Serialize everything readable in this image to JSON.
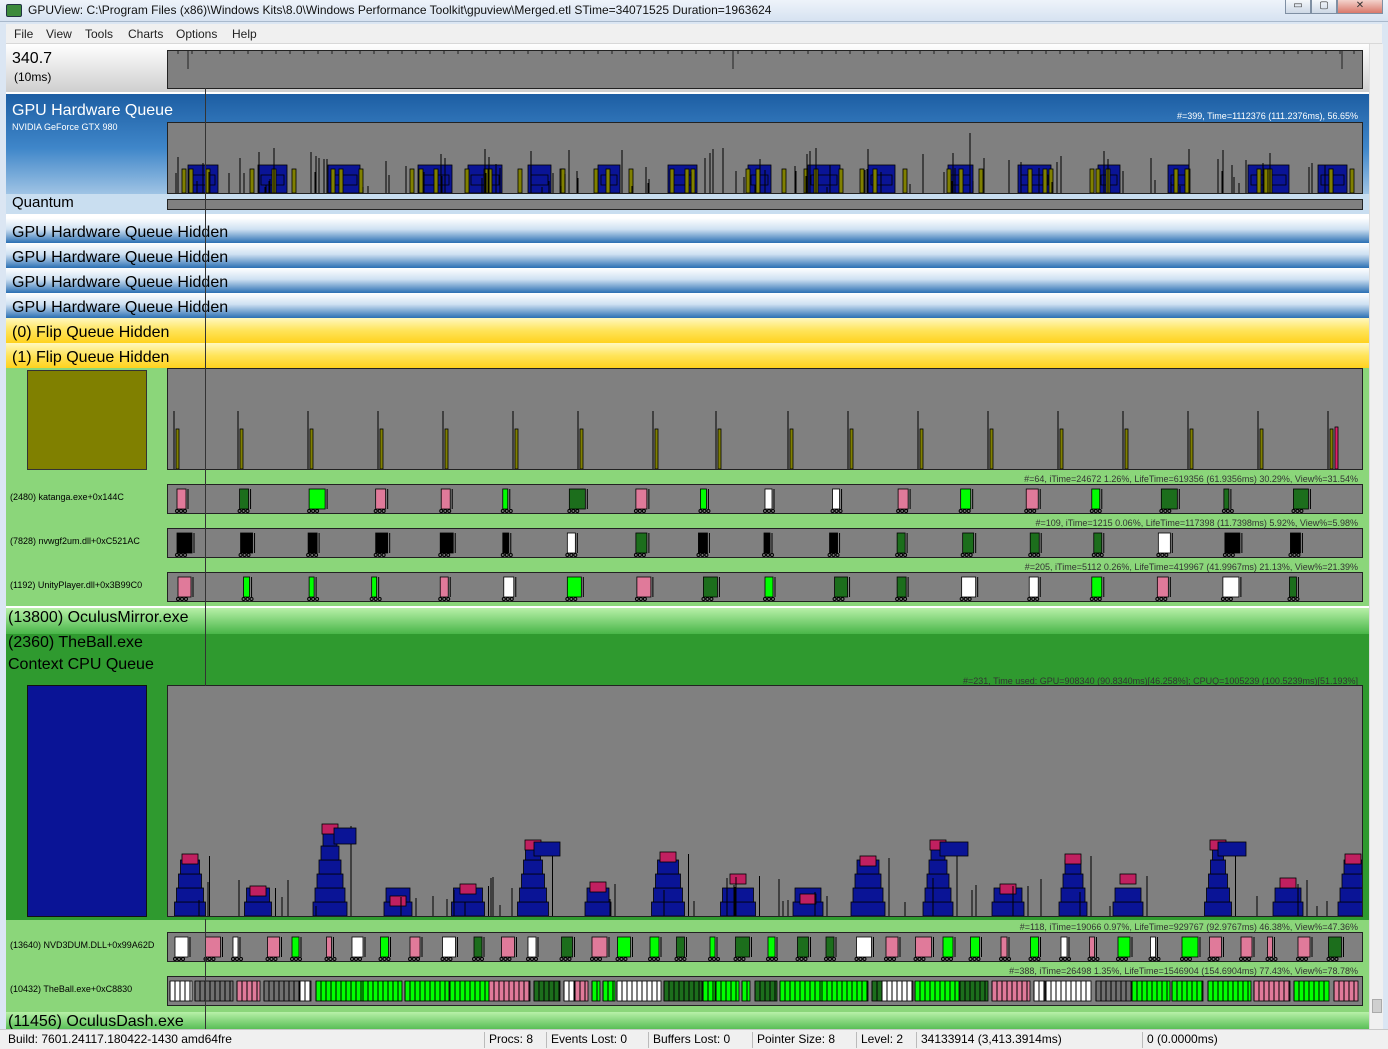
{
  "window": {
    "title": "GPUView: C:\\Program Files (x86)\\Windows Kits\\8.0\\Windows Performance Toolkit\\gpuview\\Merged.etl STime=34071525 Duration=1963624",
    "min_glyph": "▭",
    "max_glyph": "▢",
    "close_glyph": "✕"
  },
  "menu": [
    "File",
    "View",
    "Tools",
    "Charts",
    "Options",
    "Help"
  ],
  "ruler": {
    "value": "340.7",
    "unit": "(10ms)"
  },
  "gpu_queue": {
    "title": "GPU Hardware Queue",
    "device": "NVIDIA GeForce GTX 980",
    "stats": "#=399,  Time=1112376 (111.2376ms),  56.65%",
    "quantum_label": "Quantum"
  },
  "hidden_rows": [
    "GPU Hardware Queue Hidden",
    "GPU Hardware Queue Hidden",
    "GPU Hardware Queue Hidden",
    "GPU Hardware Queue Hidden"
  ],
  "flip_rows": [
    "(0) Flip Queue Hidden",
    "(1) Flip Queue Hidden"
  ],
  "process1": {
    "threads": [
      {
        "label": "(2480) katanga.exe+0x144C",
        "stats": "#=64,  iTime=24672  1.26%,  LifeTime=619356 (61.9356ms)  30.29%,  View%=31.54%"
      },
      {
        "label": "(7828) nvwgf2um.dll+0xC521AC",
        "stats": "#=109,  iTime=1215  0.06%,  LifeTime=117398 (11.7398ms)  5.92%,  View%=5.98%"
      },
      {
        "label": "(1192) UnityPlayer.dll+0x3B99C0",
        "stats": "#=205,  iTime=5112  0.26%,  LifeTime=419967 (41.9967ms)  21.13%,  View%=21.39%"
      }
    ]
  },
  "oculus_mirror": "(13800) OculusMirror.exe",
  "theball": {
    "title": "(2360) TheBall.exe",
    "queue_label": "Context CPU Queue",
    "queue_stats": "#=231, Time used: GPU=908340 (90.8340ms)[46.258%]; CPUQ=1005239 (100.5239ms)[51.193%]",
    "threads": [
      {
        "label": "(13640) NVD3DUM.DLL+0x99A62D",
        "stats": "#=118,  iTime=19066  0.97%,  LifeTime=929767 (92.9767ms)  46.38%,  View%=47.36%"
      },
      {
        "label": "(10432) TheBall.exe+0xC8830",
        "stats": "#=388,  iTime=26498  1.35%,  LifeTime=1546904 (154.6904ms)  77.43%,  View%=78.78%"
      }
    ]
  },
  "oculus_dash": "(11456) OculusDash.exe",
  "status": {
    "build": "Build: 7601.24117.180422-1430  amd64fre",
    "procs": "Procs: 8",
    "events_lost": "Events Lost: 0",
    "buffers_lost": "Buffers Lost: 0",
    "pointer_size": "Pointer Size: 8",
    "level": "Level: 2",
    "position": "34133914 (3,413.3914ms)",
    "selection": "0 (0.0000ms)"
  },
  "colors": {
    "track_bg": "#808080",
    "dma_blue": "#0a1496",
    "olive": "#808000",
    "present_pink": "#e07a9a",
    "present_green": "#00ff00",
    "present_white": "#ffffff",
    "dark_green": "#1c6e1c",
    "light_green_bg": "#8bd67a",
    "process_green": "#2f9a2f"
  }
}
